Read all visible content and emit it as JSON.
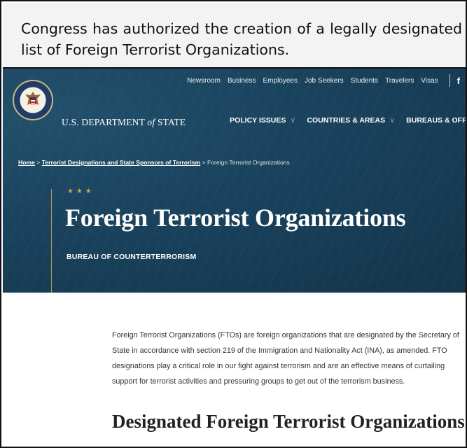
{
  "caption": {
    "text": "Congress has authorized the creation of a legally designated list of Foreign Terrorist Organizations."
  },
  "utility_nav": [
    "Newsroom",
    "Business",
    "Employees",
    "Job Seekers",
    "Students",
    "Travelers",
    "Visas"
  ],
  "social": {
    "facebook": "f"
  },
  "header": {
    "dept_prefix": "U.S. DEPARTMENT",
    "dept_of": "of",
    "dept_suffix": "STATE",
    "seal_icon": "department-of-state-seal"
  },
  "main_nav": [
    {
      "label": "POLICY ISSUES",
      "chevron": "∨"
    },
    {
      "label": "COUNTRIES & AREAS",
      "chevron": "∨"
    },
    {
      "label": "BUREAUS & OFFICES",
      "chevron": ""
    }
  ],
  "breadcrumb": {
    "home": "Home",
    "sep": ">",
    "parent": "Terrorist Designations and State Sponsors of Terrorism",
    "current": "Foreign Terrorist Organizations"
  },
  "hero": {
    "stars": "★★★",
    "title": "Foreign Terrorist Organizations",
    "bureau": "BUREAU OF COUNTERTERRORISM"
  },
  "content": {
    "intro": "Foreign Terrorist Organizations (FTOs) are foreign organizations that are designated by the Secretary of State in accordance with section 219 of the Immigration and Nationality Act (INA), as amended. FTO designations play a critical role in our fight against terrorism and are an effective means of curtailing support for terrorist activities and pressuring groups to get out of the terrorism business.",
    "subheading": "Designated Foreign Terrorist Organizations"
  },
  "colors": {
    "hero_bg": "#173c55",
    "gold_accent": "#c9a45a",
    "caption_bg": "#f3f3f3"
  }
}
